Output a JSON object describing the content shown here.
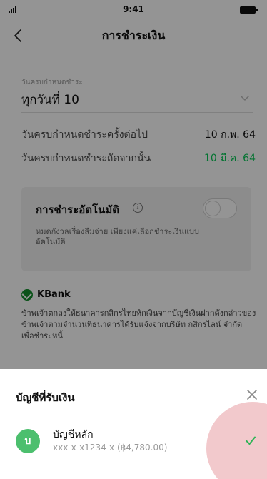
{
  "status_bar": {
    "time": "9:41"
  },
  "header": {
    "title": "การชำระเงิน"
  },
  "due": {
    "label": "วันครบกำหนดชำระ",
    "value": "ทุกวันที่ 10"
  },
  "schedule": {
    "next_label": "วันครบกำหนดชำระครั้งต่อไป",
    "next_value": "10 ก.พ. 64",
    "following_label": "วันครบกำหนดชำระถัดจากนั้น",
    "following_value": "10 มี.ค. 64",
    "following_color": "#06c755"
  },
  "auto_pay": {
    "title": "การชำระอัตโนมัติ",
    "description": "หมดกังวลเรื่องลืมจ่าย เพียงแค่เลือกชำระเงินแบบอัตโนมัติ",
    "enabled": false
  },
  "bank": {
    "name": "KBank",
    "consent": "ข้าพเจ้าตกลงให้ธนาคารกสิกรไทยหักเงินจากบัญชีเงินฝากดังกล่าวของข้าพเจ้าตามจำนวนที่ธนาคารได้รับแจ้งจากบริษัท กสิกรไลน์ จำกัด เพื่อชำระหนี้"
  },
  "sheet": {
    "title": "บัญชีที่รับเงิน",
    "account": {
      "avatar_letter": "บ",
      "name": "บัญชีหลัก",
      "detail": "xxx-x-x1234-x (฿4,780.00)"
    }
  },
  "colors": {
    "accent_green": "#06c755",
    "avatar_green": "#4cbf6e",
    "kbank_green": "#138f2d",
    "ripple": "#f2c9cc"
  },
  "icons": [
    "signal-icon",
    "battery-icon",
    "back-icon",
    "chevron-down-icon",
    "info-icon",
    "kbank-logo-icon",
    "close-icon",
    "check-icon"
  ]
}
